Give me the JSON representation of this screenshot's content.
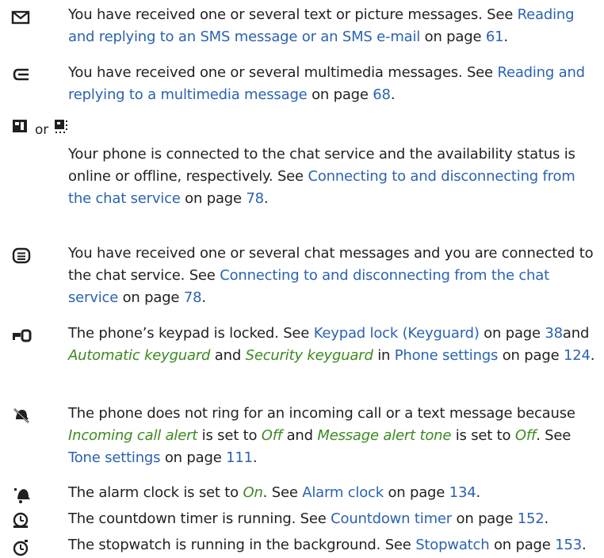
{
  "entries": [
    {
      "icon": "envelope-icon",
      "parts": [
        {
          "text": "You have received one or several text or picture messages. See "
        },
        {
          "text": "Reading and replying to an SMS message or an SMS e-mail",
          "style": "link"
        },
        {
          "text": " on page "
        },
        {
          "text": "61",
          "style": "link"
        },
        {
          "text": "."
        }
      ]
    },
    {
      "icon": "multimedia-message-icon",
      "parts": [
        {
          "text": "You have received one or several multimedia messages. See "
        },
        {
          "text": "Reading and replying to a multimedia message",
          "style": "link"
        },
        {
          "text": " on page "
        },
        {
          "text": "68",
          "style": "link"
        },
        {
          "text": "."
        }
      ]
    },
    {
      "icon": "chat-online-icon",
      "icon2": "chat-offline-icon",
      "or_word": "or",
      "parts": [
        {
          "text": "Your phone is connected to the chat service and the availability status is online or offline, respectively. See "
        },
        {
          "text": "Connecting to and disconnecting from the chat service",
          "style": "link"
        },
        {
          "text": " on page "
        },
        {
          "text": "78",
          "style": "link"
        },
        {
          "text": "."
        }
      ]
    },
    {
      "icon": "chat-message-icon",
      "parts": [
        {
          "text": "You have received one or several chat messages and you are connected to the chat service. See "
        },
        {
          "text": "Connecting to and disconnecting from the chat service",
          "style": "link"
        },
        {
          "text": " on page "
        },
        {
          "text": "78",
          "style": "link"
        },
        {
          "text": "."
        }
      ]
    },
    {
      "icon": "key-lock-icon",
      "parts": [
        {
          "text": "The phone’s keypad is locked. See "
        },
        {
          "text": "Keypad lock (Keyguard)",
          "style": "link"
        },
        {
          "text": " on page "
        },
        {
          "text": "38",
          "style": "link"
        },
        {
          "text": "and "
        },
        {
          "text": "Automatic keyguard",
          "style": "em"
        },
        {
          "text": " and "
        },
        {
          "text": "Security keyguard",
          "style": "em"
        },
        {
          "text": " in "
        },
        {
          "text": "Phone settings",
          "style": "link"
        },
        {
          "text": " on page "
        },
        {
          "text": "124",
          "style": "link"
        },
        {
          "text": "."
        }
      ]
    },
    {
      "icon": "silent-icon",
      "parts": [
        {
          "text": "The phone does not ring for an incoming call or a text message because "
        },
        {
          "text": "Incoming call alert",
          "style": "em"
        },
        {
          "text": " is set to "
        },
        {
          "text": "Off",
          "style": "em"
        },
        {
          "text": " and "
        },
        {
          "text": "Message alert tone",
          "style": "em"
        },
        {
          "text": " is set to "
        },
        {
          "text": "Off",
          "style": "em"
        },
        {
          "text": ". See "
        },
        {
          "text": "Tone settings",
          "style": "link"
        },
        {
          "text": " on page "
        },
        {
          "text": "111",
          "style": "link"
        },
        {
          "text": "."
        }
      ]
    },
    {
      "icon": "alarm-bell-icon",
      "parts": [
        {
          "text": "The alarm clock is set to "
        },
        {
          "text": "On",
          "style": "em"
        },
        {
          "text": ". See "
        },
        {
          "text": "Alarm clock",
          "style": "link"
        },
        {
          "text": " on page "
        },
        {
          "text": "134",
          "style": "link"
        },
        {
          "text": "."
        }
      ]
    },
    {
      "icon": "countdown-timer-icon",
      "parts": [
        {
          "text": "The countdown timer is running. See "
        },
        {
          "text": "Countdown timer",
          "style": "link"
        },
        {
          "text": " on page "
        },
        {
          "text": "152",
          "style": "link"
        },
        {
          "text": "."
        }
      ]
    },
    {
      "icon": "stopwatch-icon",
      "parts": [
        {
          "text": "The stopwatch is running in the background. See "
        },
        {
          "text": "Stopwatch",
          "style": "link"
        },
        {
          "text": " on page "
        },
        {
          "text": "153",
          "style": "link"
        },
        {
          "text": "."
        }
      ]
    }
  ]
}
